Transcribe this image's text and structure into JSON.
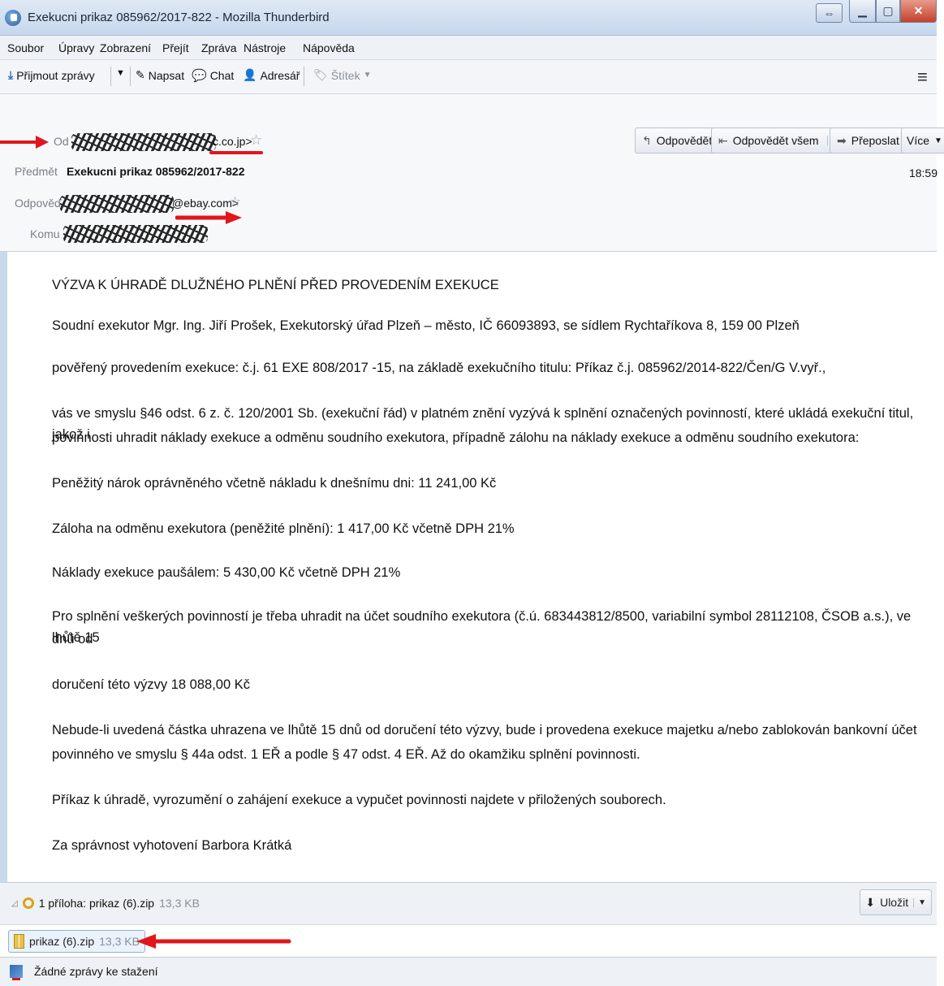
{
  "window": {
    "title": "Exekucni prikaz 085962/2017-822 - Mozilla Thunderbird"
  },
  "menubar": {
    "items": [
      "Soubor",
      "Úpravy",
      "Zobrazení",
      "Přejít",
      "Zpráva",
      "Nástroje",
      "Nápověda"
    ]
  },
  "toolbar": {
    "get_messages": "Přijmout zprávy",
    "write": "Napsat",
    "chat": "Chat",
    "address_book": "Adresář",
    "tag": "Štítek"
  },
  "header": {
    "from_label": "Od",
    "from_value_tail": "c.co.jp>",
    "subject_label": "Předmět",
    "subject": "Exekucni prikaz 085962/2017-822",
    "reply_to_label": "Odpověď",
    "reply_to_tail": "@ebay.com>",
    "to_label": "Komu",
    "time": "18:59",
    "buttons": {
      "reply": "Odpovědět",
      "reply_all": "Odpovědět všem",
      "forward": "Přeposlat",
      "more": "Více"
    }
  },
  "body": {
    "heading": "VÝZVA K ÚHRADĚ DLUŽNÉHO PLNĚNÍ PŘED PROVEDENÍM EXEKUCE",
    "p1": "Soudní exekutor Mgr. Ing. Jiří Prošek, Exekutorský úřad Plzeň – město, IČ 66093893, se sídlem Rychtaříkova 8, 159 00 Plzeň",
    "p2": "pověřený provedením exekuce: č.j. 61 EXE 808/2017 -15, na základě exekučního titulu: Příkaz č.j. 085962/2014-822/Čen/G V.vyř.,",
    "p3a": "vás ve smyslu §46 odst. 6 z. č. 120/2001 Sb. (exekuční řád) v platném znění vyzývá k splnění označených povinností, které ukládá exekuční titul, jakož i",
    "p3b": "povinnosti uhradit náklady exekuce a odměnu soudního exekutora, případně zálohu na náklady exekuce a odměnu soudního exekutora:",
    "p4": "Peněžitý nárok oprávněného včetně nákladu k dnešnímu dni: 11 241,00 Kč",
    "p5": "Záloha na odměnu exekutora (peněžité plnění): 1 417,00 Kč včetně DPH 21%",
    "p6": "Náklady exekuce paušálem: 5 430,00 Kč včetně DPH 21%",
    "p7a": "Pro splnění veškerých povinností je třeba uhradit na účet soudního exekutora (č.ú. 683443812/8500, variabilní symbol 28112108, ČSOB a.s.), ve lhůtě 15",
    "p7b": "dnů od",
    "p8": "doručení této výzvy 18 088,00 Kč",
    "p9a": "Nebude-li uvedená částka uhrazena ve lhůtě 15 dnů od doručení této výzvy, bude i provedena exekuce majetku a/nebo zablokován bankovní účet",
    "p9b": "povinného ve smyslu § 44a odst. 1 EŘ a podle § 47 odst. 4 EŘ. Až do okamžiku splnění povinnosti.",
    "p10": "Příkaz k úhradě, vyrozumění o zahájení exekuce a vypučet povinnosti najdete v přiložených souborech.",
    "p11": "Za správnost vyhotovení Barbora Krátká"
  },
  "attachments": {
    "summary_label": "1 příloha: prikaz (6).zip",
    "summary_size": "13,3 KB",
    "save": "Uložit",
    "items": [
      {
        "name": "prikaz (6).zip",
        "size": "13,3 KB"
      }
    ]
  },
  "status": {
    "text": "Žádné zprávy ke stažení"
  },
  "colors": {
    "annotation_red": "#e0161c",
    "titlebar": "#c6d7ec"
  }
}
